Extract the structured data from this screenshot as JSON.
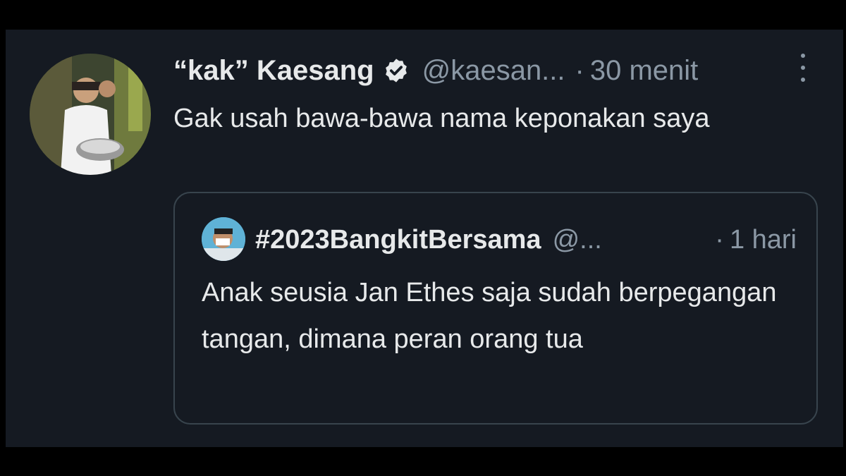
{
  "tweet": {
    "display_name": "“kak” Kaesang",
    "handle": "@kaesan...",
    "separator": "·",
    "time": "30 menit",
    "verified_icon": "verified-badge-icon",
    "more_icon": "more-vertical-icon",
    "text": "Gak usah bawa-bawa nama keponakan saya"
  },
  "quoted": {
    "display_name": "#2023BangkitBersama",
    "handle": "@...",
    "separator": "·",
    "time": "1 hari",
    "text": "Anak seusia Jan Ethes saja sudah berpegangan tangan, dimana peran orang tua"
  },
  "colors": {
    "background": "#151a22",
    "text_primary": "#e7e9ea",
    "text_secondary": "#8b98a5",
    "border": "#38444d"
  }
}
